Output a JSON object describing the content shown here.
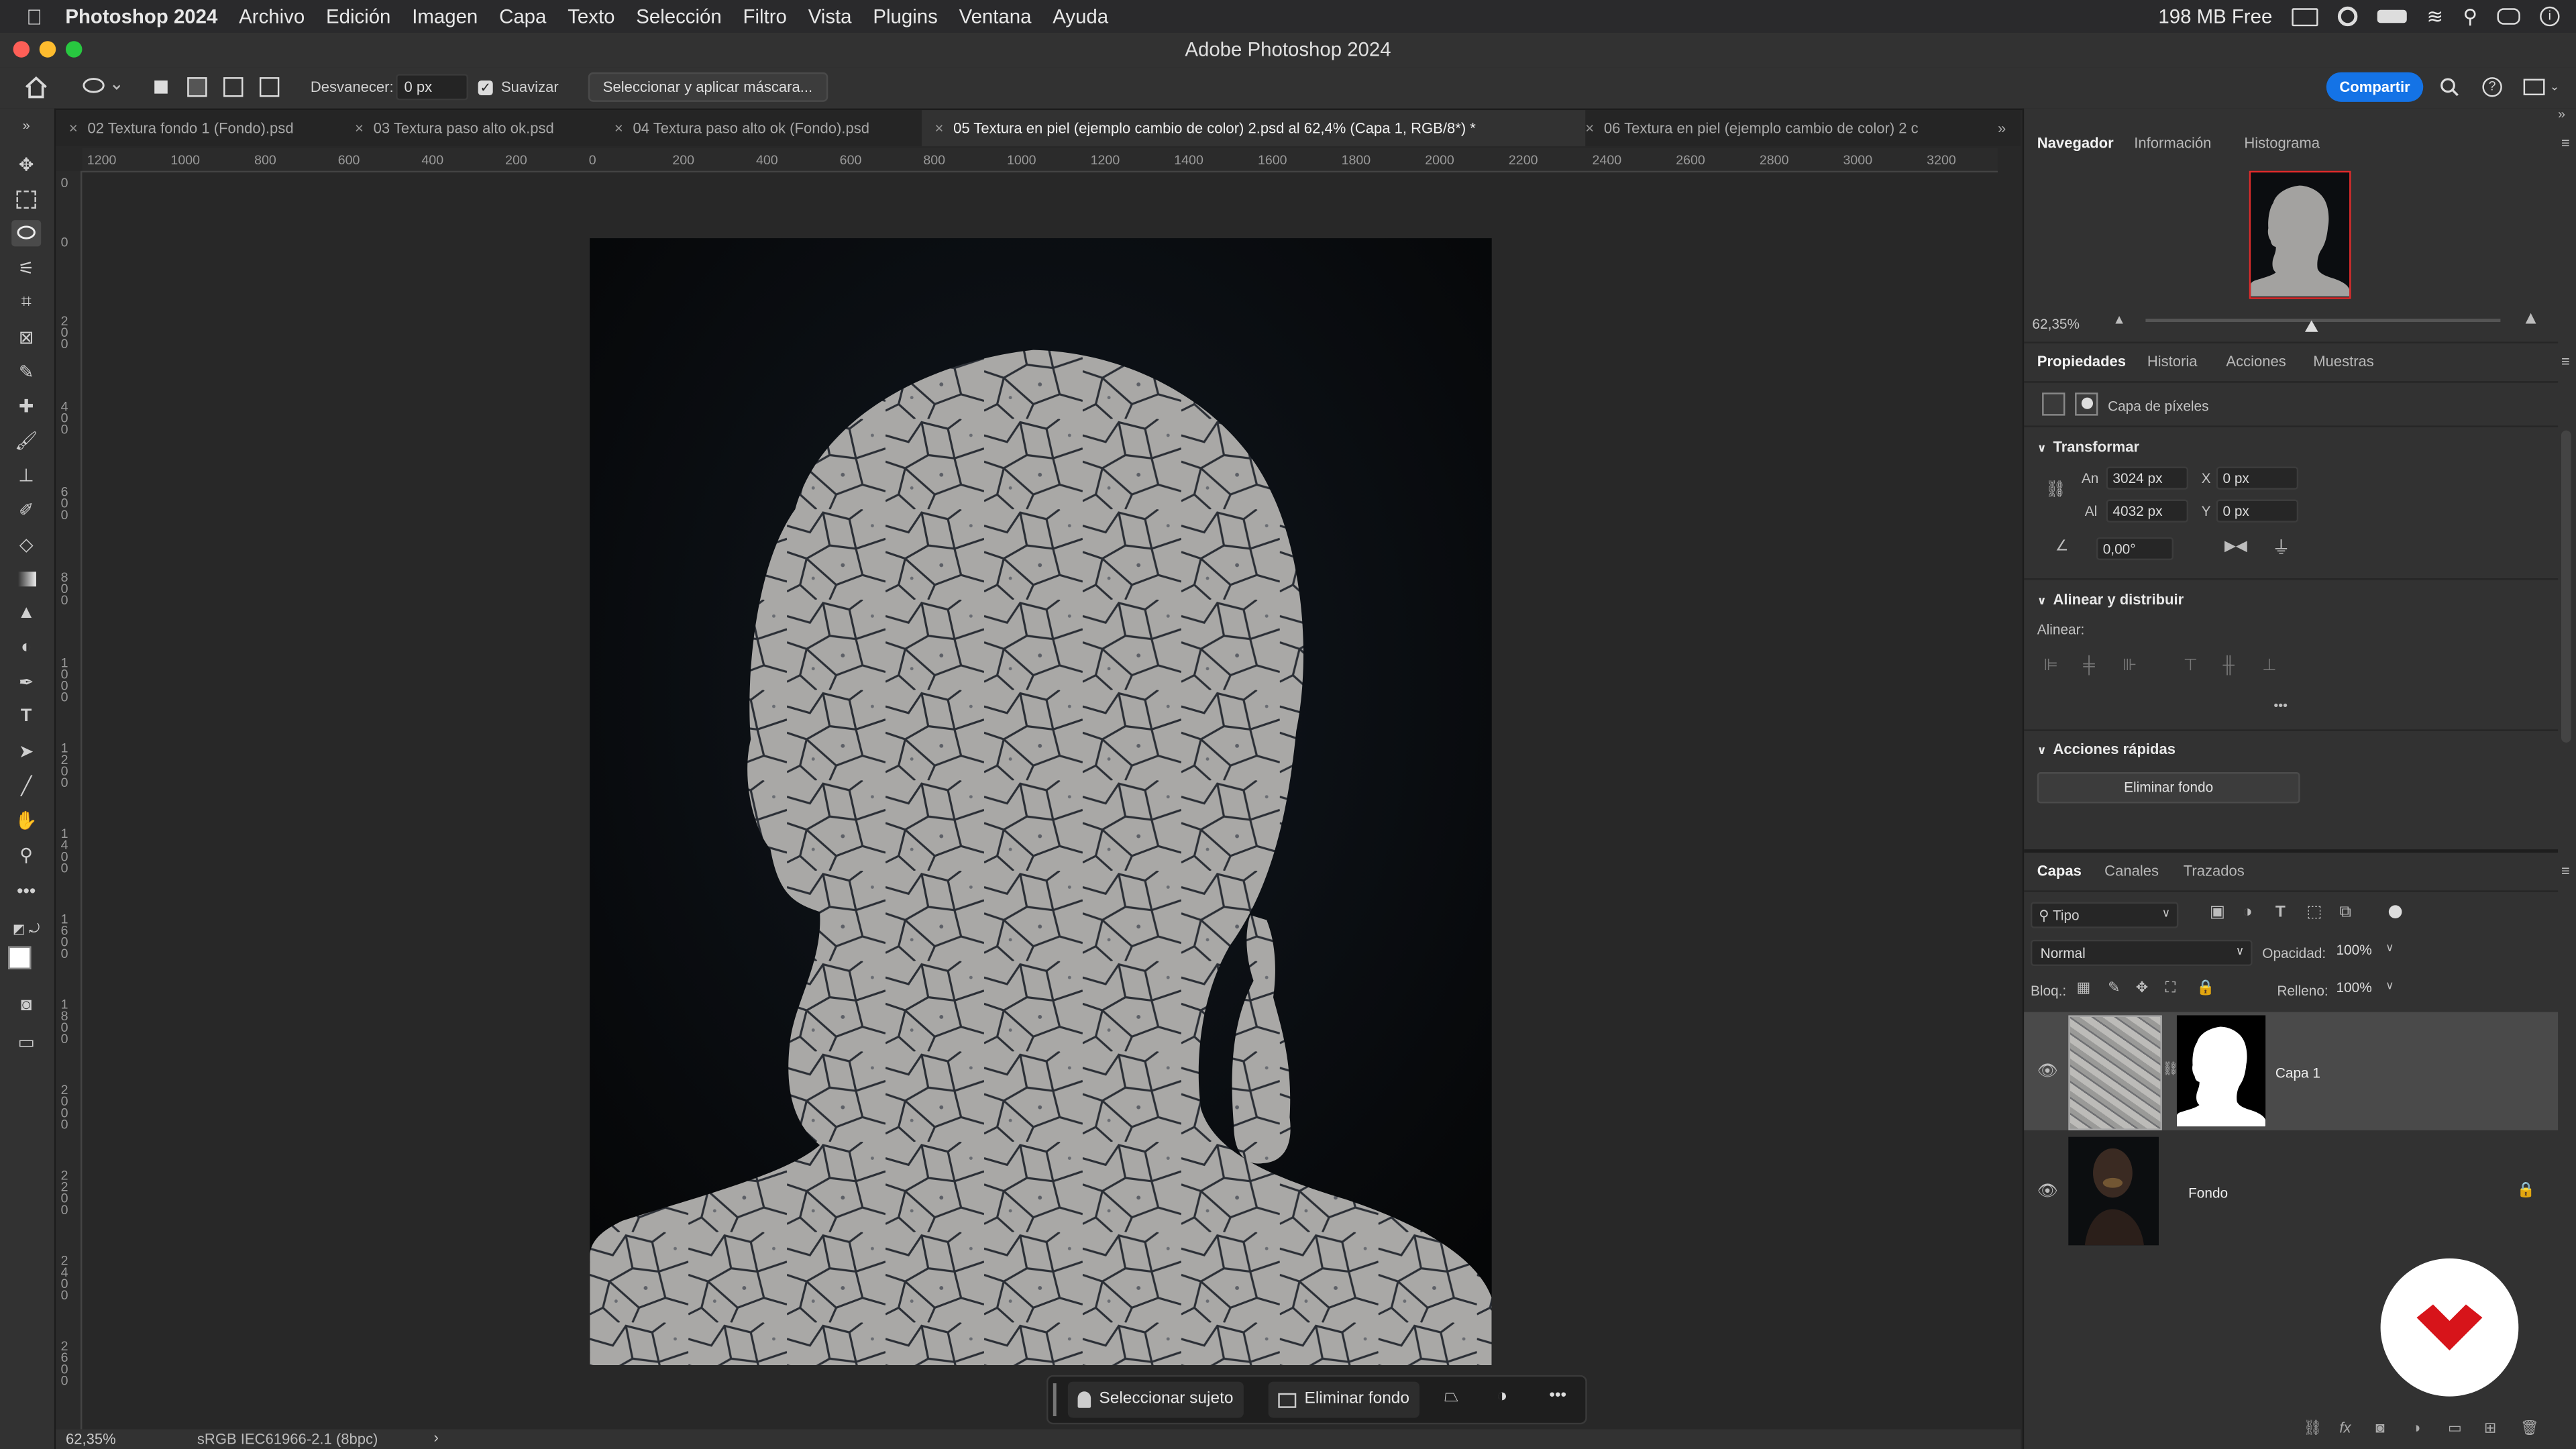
{
  "menubar": {
    "apple": "",
    "app_name": "Photoshop 2024",
    "items": [
      "Archivo",
      "Edición",
      "Imagen",
      "Capa",
      "Texto",
      "Selección",
      "Filtro",
      "Vista",
      "Plugins",
      "Ventana",
      "Ayuda"
    ],
    "memory": "198 MB Free"
  },
  "window": {
    "title": "Adobe Photoshop 2024"
  },
  "options": {
    "feather_label": "Desvanecer:",
    "feather_value": "0 px",
    "smooth_label": "Suavizar",
    "select_mask_label": "Seleccionar y aplicar máscara...",
    "share_label": "Compartir"
  },
  "tabs": [
    {
      "label": "02 Textura fondo 1 (Fondo).psd"
    },
    {
      "label": "03 Textura paso alto ok.psd"
    },
    {
      "label": "04 Textura paso alto ok (Fondo).psd"
    },
    {
      "label": "05 Textura en piel (ejemplo cambio de color) 2.psd al 62,4% (Capa 1, RGB/8*) *"
    },
    {
      "label": "06 Textura en piel (ejemplo cambio de color) 2 c"
    }
  ],
  "rulers": {
    "top": [
      "1200",
      "1000",
      "800",
      "600",
      "400",
      "200",
      "0",
      "200",
      "400",
      "600",
      "800",
      "1000",
      "1200",
      "1400",
      "1600",
      "1800",
      "2000",
      "2200",
      "2400",
      "2600",
      "2800",
      "3000",
      "3200"
    ],
    "left": [
      "0",
      "0",
      "200",
      "400",
      "600",
      "800",
      "1000",
      "1200",
      "1400",
      "1600",
      "1800",
      "2000",
      "2200",
      "2400",
      "2600"
    ]
  },
  "status": {
    "zoom": "62,35%",
    "profile": "sRGB IEC61966-2.1 (8bpc)",
    "arrow": "›"
  },
  "context_bar": {
    "select_subject": "Seleccionar sujeto",
    "remove_bg": "Eliminar fondo",
    "more": "•••"
  },
  "navigator": {
    "tabs": [
      "Navegador",
      "Información",
      "Histograma"
    ],
    "zoom": "62,35%"
  },
  "properties": {
    "tabs": [
      "Propiedades",
      "Historia",
      "Acciones",
      "Muestras"
    ],
    "layer_kind": "Capa de píxeles",
    "transform_title": "Transformar",
    "w_label": "An",
    "w_value": "3024 px",
    "h_label": "Al",
    "h_value": "4032 px",
    "x_label": "X",
    "x_value": "0 px",
    "y_label": "Y",
    "y_value": "0 px",
    "angle_value": "0,00°",
    "align_title": "Alinear y distribuir",
    "align_label": "Alinear:",
    "more": "•••",
    "quick_title": "Acciones rápidas",
    "remove_bg_button": "Eliminar fondo"
  },
  "layers": {
    "tabs": [
      "Capas",
      "Canales",
      "Trazados"
    ],
    "filter_label": "Tipo",
    "blend_mode": "Normal",
    "opacity_label": "Opacidad:",
    "opacity_value": "100%",
    "lock_label": "Bloq.:",
    "fill_label": "Relleno:",
    "fill_value": "100%",
    "items": [
      {
        "name": "Capa 1"
      },
      {
        "name": "Fondo"
      }
    ]
  },
  "colors": {
    "accent": "#1473e6",
    "logo_red": "#d7141a"
  }
}
